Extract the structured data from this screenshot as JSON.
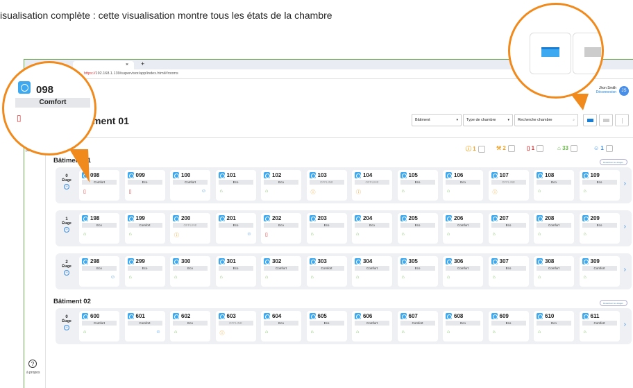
{
  "caption": "isualisation complète : cette visualisation montre tous les états de la chambre",
  "browser": {
    "tab_close": "×",
    "new_tab": "+",
    "url_https": "https://",
    "url_rest": "192.168.1.139/supervisor/app/index.html#/rooms"
  },
  "sidebar": {
    "params": "paramètres",
    "help": "?",
    "about": "à propos"
  },
  "user": {
    "name": "Jhon Smith",
    "logout": "Déconnexion",
    "initials": "JS"
  },
  "page": {
    "title": "ment 01"
  },
  "filters": {
    "building": "Bâtiment",
    "room_type": "Type de chambre",
    "search_placeholder": "Recherche chambre"
  },
  "status": {
    "warning": "1",
    "maintenance": "2",
    "alarm": "1",
    "ok": "33",
    "occupied": "1"
  },
  "magnifier": {
    "number": "098",
    "mode": "Comfort"
  },
  "buildings": [
    {
      "name": "Bâtiment 01",
      "pill": "Désactiver les étages",
      "floors": [
        {
          "n": "0",
          "label": "Étage",
          "rooms": [
            {
              "num": "098",
              "mode": "Comfort",
              "sym": "err"
            },
            {
              "num": "099",
              "mode": "Eco",
              "sym": "err"
            },
            {
              "num": "100",
              "mode": "Comfort",
              "sym": "user"
            },
            {
              "num": "101",
              "mode": "Eco",
              "sym": "ok"
            },
            {
              "num": "102",
              "mode": "Eco",
              "sym": "ok"
            },
            {
              "num": "103",
              "mode": "OFFLINE",
              "sym": "warn"
            },
            {
              "num": "104",
              "mode": "OFFLINE",
              "sym": "warn"
            },
            {
              "num": "105",
              "mode": "Eco",
              "sym": "ok"
            },
            {
              "num": "106",
              "mode": "Eco",
              "sym": "ok"
            },
            {
              "num": "107",
              "mode": "OFFLINE",
              "sym": "warn"
            },
            {
              "num": "108",
              "mode": "Eco",
              "sym": "ok"
            },
            {
              "num": "109",
              "mode": "Eco",
              "sym": "ok"
            }
          ]
        },
        {
          "n": "1",
          "label": "Étage",
          "rooms": [
            {
              "num": "198",
              "mode": "Eco",
              "sym": "ok"
            },
            {
              "num": "199",
              "mode": "Comfort",
              "sym": "ok"
            },
            {
              "num": "200",
              "mode": "OFFLINE",
              "sym": "warn"
            },
            {
              "num": "201",
              "mode": "Eco",
              "sym": "user"
            },
            {
              "num": "202",
              "mode": "Eco",
              "sym": "err"
            },
            {
              "num": "203",
              "mode": "Eco",
              "sym": "ok"
            },
            {
              "num": "204",
              "mode": "Eco",
              "sym": "ok"
            },
            {
              "num": "205",
              "mode": "Eco",
              "sym": "ok"
            },
            {
              "num": "206",
              "mode": "Comfort",
              "sym": "ok"
            },
            {
              "num": "207",
              "mode": "Eco",
              "sym": "ok"
            },
            {
              "num": "208",
              "mode": "Comfort",
              "sym": "ok"
            },
            {
              "num": "209",
              "mode": "Eco",
              "sym": "ok"
            }
          ]
        },
        {
          "n": "2",
          "label": "Étage",
          "rooms": [
            {
              "num": "298",
              "mode": "Eco",
              "sym": "user"
            },
            {
              "num": "299",
              "mode": "Eco",
              "sym": "ok"
            },
            {
              "num": "300",
              "mode": "Eco",
              "sym": "ok"
            },
            {
              "num": "301",
              "mode": "Eco",
              "sym": "ok"
            },
            {
              "num": "302",
              "mode": "Comfort",
              "sym": "ok"
            },
            {
              "num": "303",
              "mode": "Comfort",
              "sym": "ok"
            },
            {
              "num": "304",
              "mode": "Comfort",
              "sym": "ok"
            },
            {
              "num": "305",
              "mode": "Eco",
              "sym": "ok"
            },
            {
              "num": "306",
              "mode": "Comfort",
              "sym": "ok"
            },
            {
              "num": "307",
              "mode": "Eco",
              "sym": "ok"
            },
            {
              "num": "308",
              "mode": "Comfort",
              "sym": "ok"
            },
            {
              "num": "309",
              "mode": "Comfort",
              "sym": "ok"
            }
          ]
        }
      ]
    },
    {
      "name": "Bâtiment 02",
      "pill": "Désactiver les étages",
      "floors": [
        {
          "n": "0",
          "label": "Étage",
          "rooms": [
            {
              "num": "600",
              "mode": "Comfort",
              "sym": "ok"
            },
            {
              "num": "601",
              "mode": "Comfort",
              "sym": "user"
            },
            {
              "num": "602",
              "mode": "Eco",
              "sym": "ok"
            },
            {
              "num": "603",
              "mode": "OFFLINE",
              "sym": "warn"
            },
            {
              "num": "604",
              "mode": "Eco",
              "sym": "ok"
            },
            {
              "num": "605",
              "mode": "Eco",
              "sym": "ok"
            },
            {
              "num": "606",
              "mode": "Comfort",
              "sym": "ok"
            },
            {
              "num": "607",
              "mode": "Comfort",
              "sym": "ok"
            },
            {
              "num": "608",
              "mode": "Eco",
              "sym": "ok"
            },
            {
              "num": "609",
              "mode": "Eco",
              "sym": "ok"
            },
            {
              "num": "610",
              "mode": "Eco",
              "sym": "ok"
            },
            {
              "num": "611",
              "mode": "Comfort",
              "sym": "ok"
            }
          ]
        }
      ]
    }
  ],
  "colors": {
    "accent": "#3ca9f0",
    "callout": "#f08a1d",
    "ok": "#6aba4a",
    "warn": "#f0a020",
    "err": "#d33333",
    "user": "#3c8dde"
  }
}
